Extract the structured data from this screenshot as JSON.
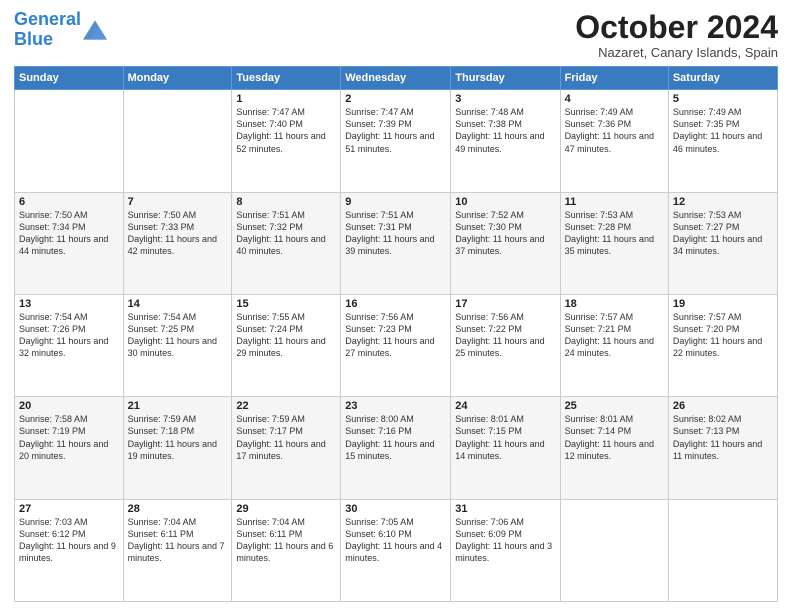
{
  "logo": {
    "line1": "General",
    "line2": "Blue"
  },
  "title": "October 2024",
  "location": "Nazaret, Canary Islands, Spain",
  "weekdays": [
    "Sunday",
    "Monday",
    "Tuesday",
    "Wednesday",
    "Thursday",
    "Friday",
    "Saturday"
  ],
  "weeks": [
    [
      {
        "day": "",
        "info": ""
      },
      {
        "day": "",
        "info": ""
      },
      {
        "day": "1",
        "info": "Sunrise: 7:47 AM\nSunset: 7:40 PM\nDaylight: 11 hours and 52 minutes."
      },
      {
        "day": "2",
        "info": "Sunrise: 7:47 AM\nSunset: 7:39 PM\nDaylight: 11 hours and 51 minutes."
      },
      {
        "day": "3",
        "info": "Sunrise: 7:48 AM\nSunset: 7:38 PM\nDaylight: 11 hours and 49 minutes."
      },
      {
        "day": "4",
        "info": "Sunrise: 7:49 AM\nSunset: 7:36 PM\nDaylight: 11 hours and 47 minutes."
      },
      {
        "day": "5",
        "info": "Sunrise: 7:49 AM\nSunset: 7:35 PM\nDaylight: 11 hours and 46 minutes."
      }
    ],
    [
      {
        "day": "6",
        "info": "Sunrise: 7:50 AM\nSunset: 7:34 PM\nDaylight: 11 hours and 44 minutes."
      },
      {
        "day": "7",
        "info": "Sunrise: 7:50 AM\nSunset: 7:33 PM\nDaylight: 11 hours and 42 minutes."
      },
      {
        "day": "8",
        "info": "Sunrise: 7:51 AM\nSunset: 7:32 PM\nDaylight: 11 hours and 40 minutes."
      },
      {
        "day": "9",
        "info": "Sunrise: 7:51 AM\nSunset: 7:31 PM\nDaylight: 11 hours and 39 minutes."
      },
      {
        "day": "10",
        "info": "Sunrise: 7:52 AM\nSunset: 7:30 PM\nDaylight: 11 hours and 37 minutes."
      },
      {
        "day": "11",
        "info": "Sunrise: 7:53 AM\nSunset: 7:28 PM\nDaylight: 11 hours and 35 minutes."
      },
      {
        "day": "12",
        "info": "Sunrise: 7:53 AM\nSunset: 7:27 PM\nDaylight: 11 hours and 34 minutes."
      }
    ],
    [
      {
        "day": "13",
        "info": "Sunrise: 7:54 AM\nSunset: 7:26 PM\nDaylight: 11 hours and 32 minutes."
      },
      {
        "day": "14",
        "info": "Sunrise: 7:54 AM\nSunset: 7:25 PM\nDaylight: 11 hours and 30 minutes."
      },
      {
        "day": "15",
        "info": "Sunrise: 7:55 AM\nSunset: 7:24 PM\nDaylight: 11 hours and 29 minutes."
      },
      {
        "day": "16",
        "info": "Sunrise: 7:56 AM\nSunset: 7:23 PM\nDaylight: 11 hours and 27 minutes."
      },
      {
        "day": "17",
        "info": "Sunrise: 7:56 AM\nSunset: 7:22 PM\nDaylight: 11 hours and 25 minutes."
      },
      {
        "day": "18",
        "info": "Sunrise: 7:57 AM\nSunset: 7:21 PM\nDaylight: 11 hours and 24 minutes."
      },
      {
        "day": "19",
        "info": "Sunrise: 7:57 AM\nSunset: 7:20 PM\nDaylight: 11 hours and 22 minutes."
      }
    ],
    [
      {
        "day": "20",
        "info": "Sunrise: 7:58 AM\nSunset: 7:19 PM\nDaylight: 11 hours and 20 minutes."
      },
      {
        "day": "21",
        "info": "Sunrise: 7:59 AM\nSunset: 7:18 PM\nDaylight: 11 hours and 19 minutes."
      },
      {
        "day": "22",
        "info": "Sunrise: 7:59 AM\nSunset: 7:17 PM\nDaylight: 11 hours and 17 minutes."
      },
      {
        "day": "23",
        "info": "Sunrise: 8:00 AM\nSunset: 7:16 PM\nDaylight: 11 hours and 15 minutes."
      },
      {
        "day": "24",
        "info": "Sunrise: 8:01 AM\nSunset: 7:15 PM\nDaylight: 11 hours and 14 minutes."
      },
      {
        "day": "25",
        "info": "Sunrise: 8:01 AM\nSunset: 7:14 PM\nDaylight: 11 hours and 12 minutes."
      },
      {
        "day": "26",
        "info": "Sunrise: 8:02 AM\nSunset: 7:13 PM\nDaylight: 11 hours and 11 minutes."
      }
    ],
    [
      {
        "day": "27",
        "info": "Sunrise: 7:03 AM\nSunset: 6:12 PM\nDaylight: 11 hours and 9 minutes."
      },
      {
        "day": "28",
        "info": "Sunrise: 7:04 AM\nSunset: 6:11 PM\nDaylight: 11 hours and 7 minutes."
      },
      {
        "day": "29",
        "info": "Sunrise: 7:04 AM\nSunset: 6:11 PM\nDaylight: 11 hours and 6 minutes."
      },
      {
        "day": "30",
        "info": "Sunrise: 7:05 AM\nSunset: 6:10 PM\nDaylight: 11 hours and 4 minutes."
      },
      {
        "day": "31",
        "info": "Sunrise: 7:06 AM\nSunset: 6:09 PM\nDaylight: 11 hours and 3 minutes."
      },
      {
        "day": "",
        "info": ""
      },
      {
        "day": "",
        "info": ""
      }
    ]
  ]
}
